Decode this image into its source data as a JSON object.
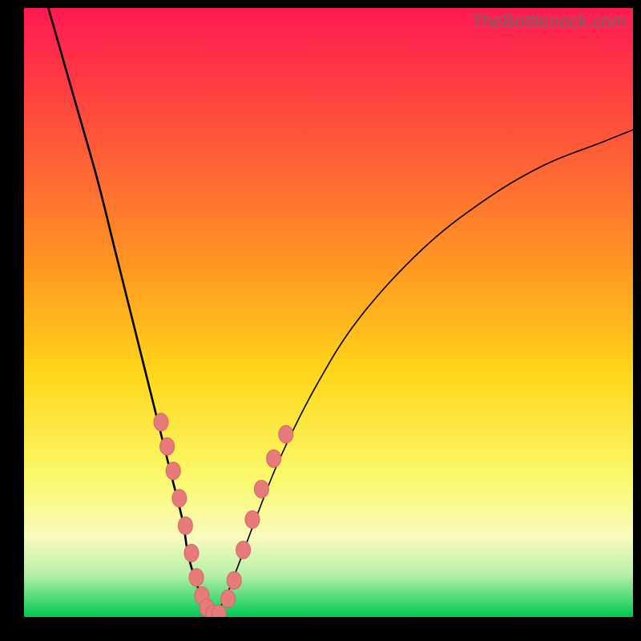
{
  "watermark": "TheBottleneck.com",
  "colors": {
    "bead": "#e77b7b",
    "curve": "#000000",
    "frame": "#000000"
  },
  "chart_data": {
    "type": "line",
    "title": "",
    "xlabel": "",
    "ylabel": "",
    "xlim": [
      0,
      100
    ],
    "ylim": [
      0,
      100
    ],
    "grid": false,
    "note": "Values estimated from pixel positions; no numeric axis labels present.",
    "series": [
      {
        "name": "left-curve",
        "x": [
          4,
          8,
          12,
          15,
          18,
          20,
          22,
          24,
          26,
          27,
          28.5,
          30,
          31
        ],
        "y": [
          100,
          86,
          72,
          60,
          48,
          40,
          32,
          24,
          16,
          10,
          5,
          1,
          0
        ]
      },
      {
        "name": "right-curve",
        "x": [
          31,
          33,
          35,
          38,
          42,
          48,
          55,
          65,
          75,
          85,
          95,
          100
        ],
        "y": [
          0,
          3,
          8,
          16,
          26,
          38,
          49,
          60,
          68,
          74,
          78,
          80
        ]
      }
    ],
    "markers": {
      "name": "highlight-beads",
      "color": "#e77b7b",
      "points": [
        {
          "x": 22.5,
          "y": 32
        },
        {
          "x": 23.5,
          "y": 28
        },
        {
          "x": 24.5,
          "y": 24
        },
        {
          "x": 25.5,
          "y": 19.5
        },
        {
          "x": 26.5,
          "y": 15
        },
        {
          "x": 27.5,
          "y": 10.5
        },
        {
          "x": 28.3,
          "y": 6.5
        },
        {
          "x": 29.2,
          "y": 3.5
        },
        {
          "x": 30.0,
          "y": 1.5
        },
        {
          "x": 31.0,
          "y": 0.5
        },
        {
          "x": 32.0,
          "y": 0.5
        },
        {
          "x": 33.5,
          "y": 3
        },
        {
          "x": 34.5,
          "y": 6
        },
        {
          "x": 36.0,
          "y": 11
        },
        {
          "x": 37.5,
          "y": 16
        },
        {
          "x": 39.0,
          "y": 21
        },
        {
          "x": 41.0,
          "y": 26
        },
        {
          "x": 43.0,
          "y": 30
        }
      ]
    }
  }
}
